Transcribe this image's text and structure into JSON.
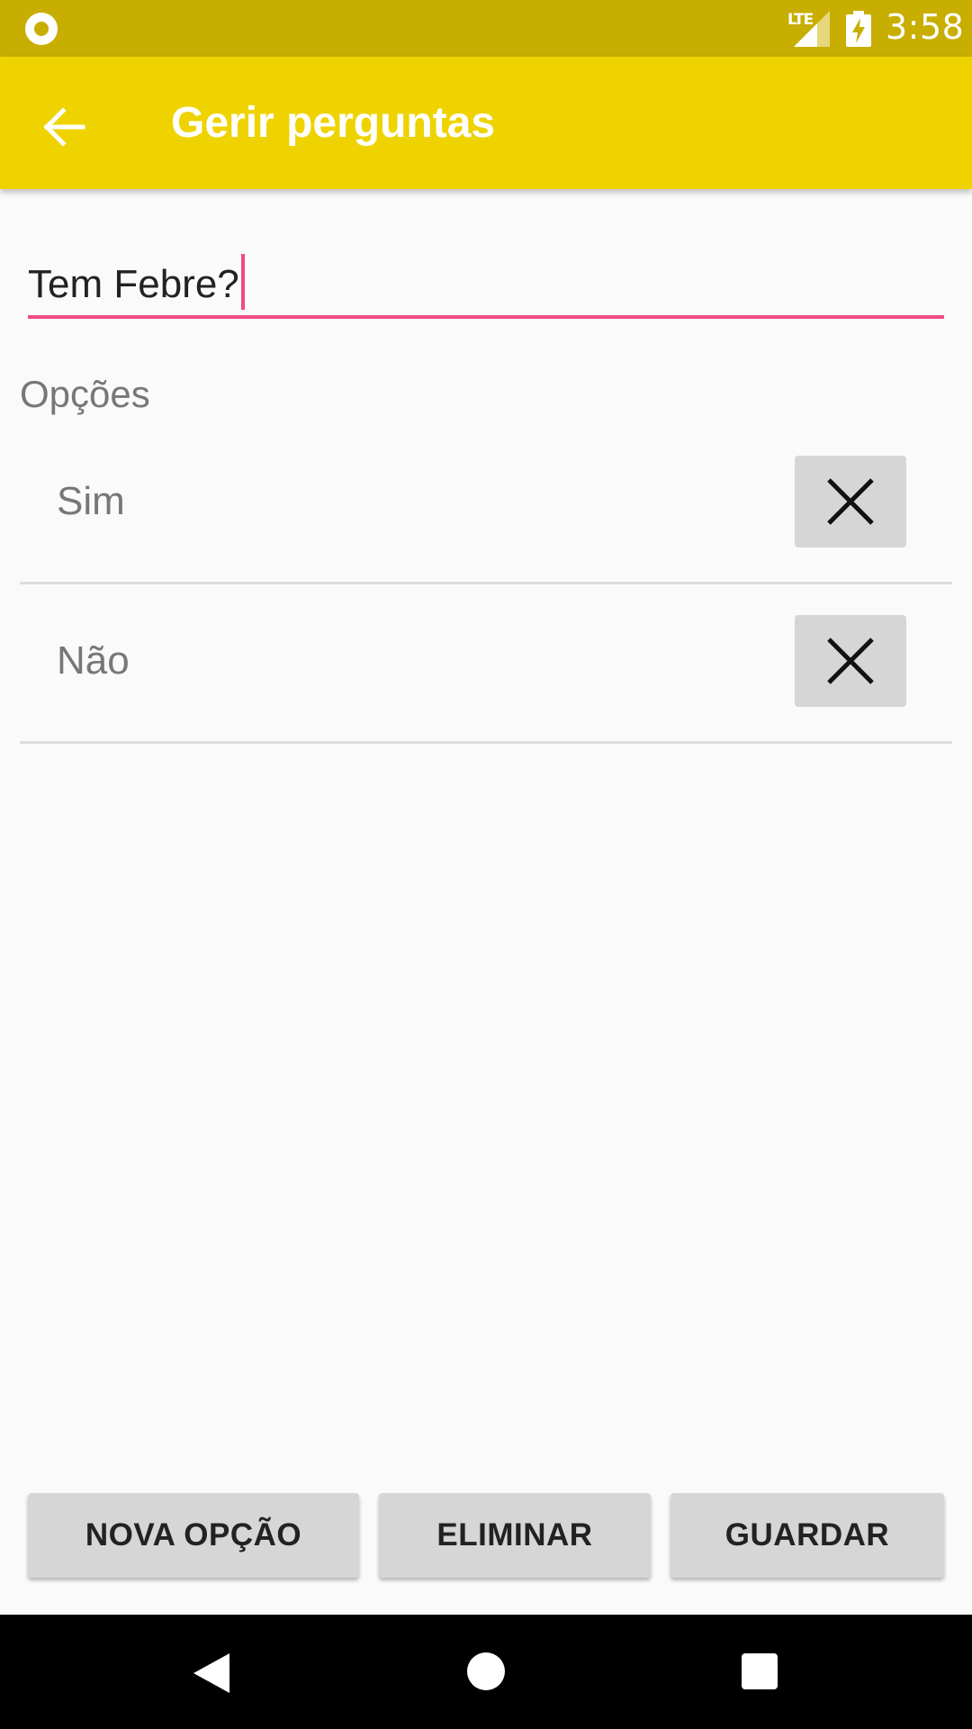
{
  "status_bar": {
    "network": "LTE",
    "time": "3:58",
    "icons": [
      "notification-dot-icon",
      "signal-icon",
      "battery-charging-icon"
    ]
  },
  "app_bar": {
    "title": "Gerir perguntas",
    "back_icon": "arrow-back-icon",
    "color": "#efd300"
  },
  "question": {
    "value": "Tem Febre?",
    "accent_color": "#ef4c86"
  },
  "options": {
    "label": "Opções",
    "items": [
      {
        "label": "Sim",
        "remove_icon": "close-icon"
      },
      {
        "label": "Não",
        "remove_icon": "close-icon"
      }
    ]
  },
  "actions": {
    "new_option": "NOVA OPÇÃO",
    "delete": "ELIMINAR",
    "save": "GUARDAR"
  },
  "nav_bar": {
    "icons": [
      "nav-back-icon",
      "nav-home-icon",
      "nav-recents-icon"
    ]
  }
}
